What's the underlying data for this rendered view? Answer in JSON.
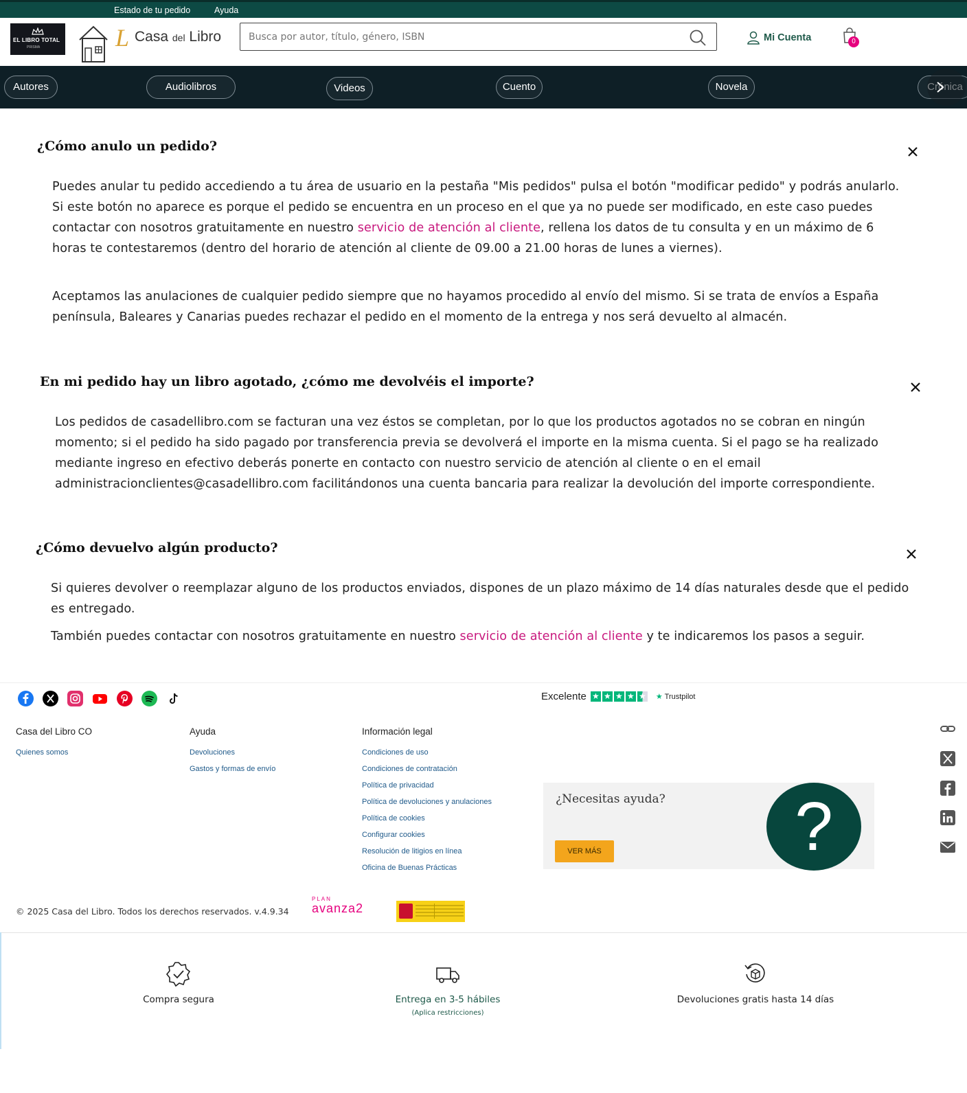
{
  "topbar": {
    "order_status": "Estado de tu pedido",
    "help": "Ayuda"
  },
  "header": {
    "partner_logo_text": "EL LIBRO TOTAL",
    "partner_logo_sub": "PRISMA",
    "brand_prefix": "Casa",
    "brand_mid": "del",
    "brand_suffix": "Libro",
    "search_placeholder": "Busca por autor, título, género, ISBN",
    "account_label": "Mi Cuenta",
    "cart_count": "0"
  },
  "categories": [
    "Autores",
    "Audiolibros",
    "Videos",
    "Cuento",
    "Novela",
    "Crónica"
  ],
  "faq": [
    {
      "question": "¿Cómo anulo un pedido?",
      "p1_before": "Puedes anular tu pedido accediendo a tu área de usuario en la pestaña \"Mis pedidos\" pulsa el botón \"modificar pedido\" y podrás anularlo. Si este botón no aparece es porque el pedido se encuentra en un proceso en el que ya no puede ser modificado, en este caso puedes contactar con nosotros gratuitamente en nuestro ",
      "p1_link": "servicio de atención al cliente",
      "p1_after": ", rellena los datos de tu consulta y en un máximo de 6 horas te contestaremos (dentro del horario de atención al cliente de 09.00 a 21.00 horas de lunes a viernes).",
      "p2": "Aceptamos las anulaciones de cualquier pedido siempre que no hayamos procedido al envío del mismo. Si se trata de envíos a España península, Baleares y Canarias puedes rechazar el pedido en el momento de la entrega y nos será devuelto al almacén."
    },
    {
      "question": "En mi pedido hay un libro agotado, ¿cómo me devolvéis el importe?",
      "p1": "Los pedidos de casadellibro.com se facturan una vez éstos se completan, por lo que los productos agotados no se cobran en ningún momento; si el pedido ha sido pagado por transferencia previa se devolverá el importe en la misma cuenta. Si el pago se ha realizado mediante ingreso en efectivo deberás ponerte en contacto con nuestro servicio de atención al cliente o en el email administracionclientes@casadellibro.com facilitándonos una cuenta bancaria para realizar la devolución del importe correspondiente."
    },
    {
      "question": "¿Cómo devuelvo algún producto?",
      "p1": "Si quieres devolver o reemplazar alguno de los productos enviados, dispones de un plazo máximo de 14 días naturales desde que el pedido es entregado.",
      "p2_before": "También puedes contactar con nosotros gratuitamente en nuestro ",
      "p2_link": "servicio de atención al cliente",
      "p2_after": " y te indicaremos los pasos a seguir."
    }
  ],
  "footer": {
    "social_icons": [
      "facebook-icon",
      "x-icon",
      "instagram-icon",
      "youtube-icon",
      "pinterest-icon",
      "spotify-icon",
      "tiktok-icon"
    ],
    "trustpilot": {
      "rating_label": "Excelente",
      "brand": "Trustpilot",
      "stars": 4.5
    },
    "col1": {
      "title": "Casa del Libro CO",
      "links": [
        "Quienes somos"
      ]
    },
    "col2": {
      "title": "Ayuda",
      "links": [
        "Devoluciones",
        "Gastos y formas de envío"
      ]
    },
    "col3": {
      "title": "Información legal",
      "links": [
        "Condiciones de uso",
        "Condiciones de contratación",
        "Política de privacidad",
        "Política de devoluciones y anulaciones",
        "Política de cookies",
        "Configurar cookies",
        "Resolución de litigios en línea",
        "Oficina de Buenas Prácticas"
      ]
    },
    "help_card": {
      "question": "¿Necesitas ayuda?",
      "button": "VER MÁS"
    },
    "copyright": "© 2025 Casa del Libro. Todos los derechos reservados. v.4.9.34",
    "avanza_top": "PLAN",
    "avanza": "avanza2",
    "share_icons": [
      "link-icon",
      "x-icon",
      "facebook-icon",
      "linkedin-icon",
      "email-icon"
    ]
  },
  "benefits": [
    {
      "title": "Compra segura",
      "sub": ""
    },
    {
      "title": "Entrega en 3-5 hábiles",
      "sub": "(Aplica restricciones)"
    },
    {
      "title": "Devoluciones gratis hasta 14 días",
      "sub": ""
    }
  ],
  "colors": {
    "primary_green": "#0d4a44",
    "nav_dark": "#0e1f26",
    "link_pink": "#c8197e",
    "cta_orange": "#f3a51c",
    "trust_green": "#00b67a"
  }
}
